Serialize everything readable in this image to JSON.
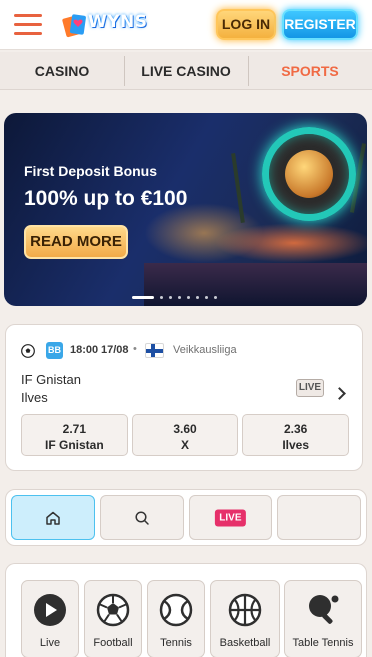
{
  "header": {
    "logo_text": "WYNS",
    "login_label": "LOG IN",
    "register_label": "REGISTER"
  },
  "tabs": [
    {
      "label": "CASINO",
      "active": false
    },
    {
      "label": "LIVE CASINO",
      "active": false
    },
    {
      "label": "SPORTS",
      "active": true
    }
  ],
  "banner": {
    "subtitle": "First Deposit Bonus",
    "title": "100% up to €100",
    "button_label": "READ MORE",
    "slide_count": 8,
    "active_slide": 1
  },
  "match": {
    "sport_icon": "soccer-ball-icon",
    "badge": "BB",
    "time": "18:00",
    "date": "17/08",
    "league": "Veikkausliiga",
    "country_flag": "finland-flag-icon",
    "team_home": "IF Gnistan",
    "team_away": "Ilves",
    "live_label": "LIVE",
    "odds": [
      {
        "value": "2.71",
        "label": "IF Gnistan"
      },
      {
        "value": "3.60",
        "label": "X"
      },
      {
        "value": "2.36",
        "label": "Ilves"
      }
    ]
  },
  "filter": {
    "live_label": "LIVE"
  },
  "sports": [
    {
      "label": "Live",
      "icon": "play-icon"
    },
    {
      "label": "Football",
      "icon": "football-icon"
    },
    {
      "label": "Tennis",
      "icon": "tennis-ball-icon"
    },
    {
      "label": "Basketball",
      "icon": "basketball-icon"
    },
    {
      "label": "Table Tennis",
      "icon": "table-tennis-icon"
    }
  ],
  "colors": {
    "accent_orange": "#f06a44",
    "login_gold": "#f4b13f",
    "register_blue": "#1396e6",
    "live_pink": "#e6306a"
  }
}
